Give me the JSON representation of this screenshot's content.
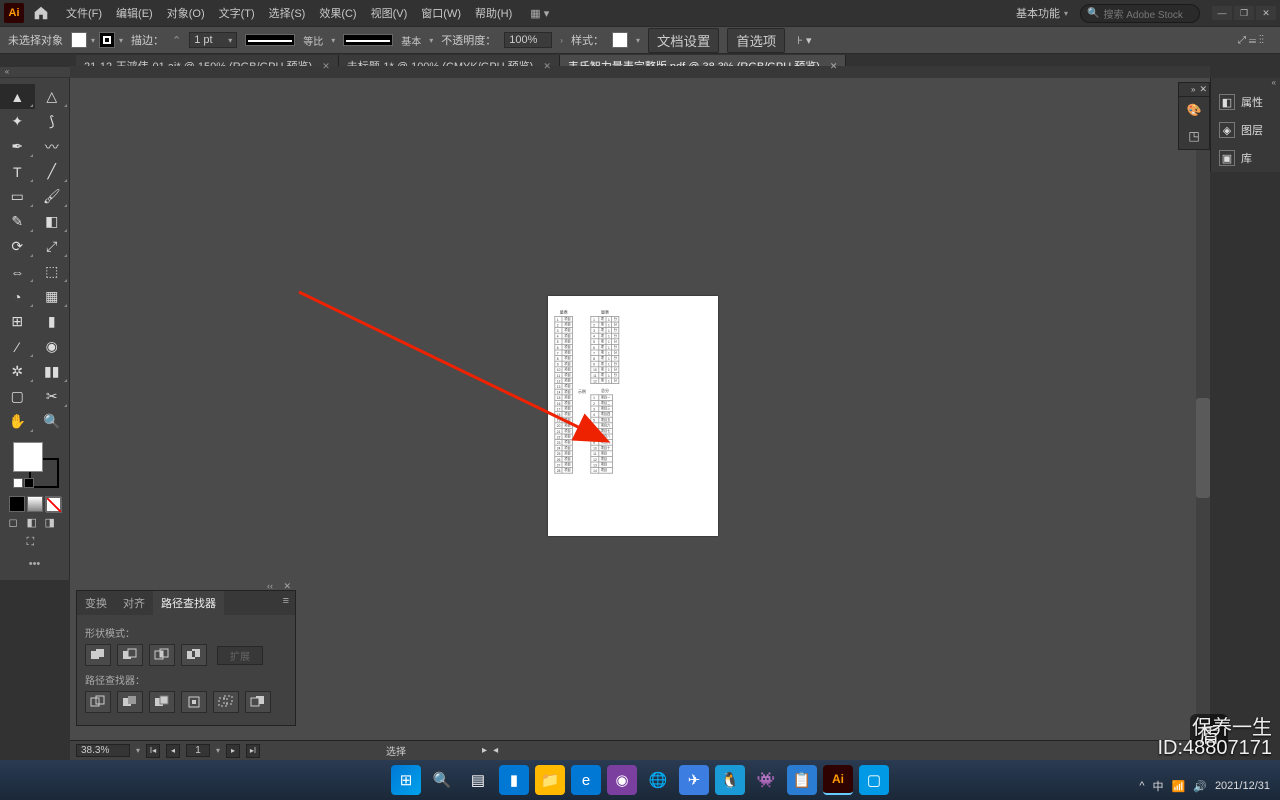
{
  "title": {
    "app": "Ai"
  },
  "menu": [
    "文件(F)",
    "编辑(E)",
    "对象(O)",
    "文字(T)",
    "选择(S)",
    "效果(C)",
    "视图(V)",
    "窗口(W)",
    "帮助(H)"
  ],
  "workspace": {
    "label": "基本功能",
    "search_placeholder": "搜索 Adobe Stock"
  },
  "controlbar": {
    "no_selection": "未选择对象",
    "stroke_label": "描边：",
    "stroke_val": "1 pt",
    "uniform": "等比",
    "basic": "基本",
    "opacity_label": "不透明度：",
    "opacity_val": "100%",
    "style_label": "样式：",
    "doc_setup": "文档设置",
    "prefs": "首选项"
  },
  "tabs": [
    {
      "label": "21-12-王鸿伟-01.ai* @ 150% (RGB/GPU 预览)",
      "active": false
    },
    {
      "label": "未标题-1* @ 100% (CMYK/GPU 预览)",
      "active": false
    },
    {
      "label": "韦氏智力量表完整版.pdf @ 38.3% (RGB/GPU 预览)",
      "active": true
    }
  ],
  "right_panels": [
    {
      "icon": "◧",
      "label": "属性"
    },
    {
      "icon": "◈",
      "label": "图层"
    },
    {
      "icon": "▣",
      "label": "库"
    }
  ],
  "pathfinder": {
    "tabs": [
      "变换",
      "对齐",
      "路径查找器"
    ],
    "active_tab": 2,
    "shape_label": "形状模式：",
    "expand": "扩展",
    "pf_label": "路径查找器："
  },
  "status": {
    "zoom": "38.3%",
    "page": "1",
    "tool": "选择"
  },
  "tray": {
    "ime": "中",
    "id": "ID:48807171",
    "brand": "保养一生",
    "date": "2021/12/31"
  }
}
